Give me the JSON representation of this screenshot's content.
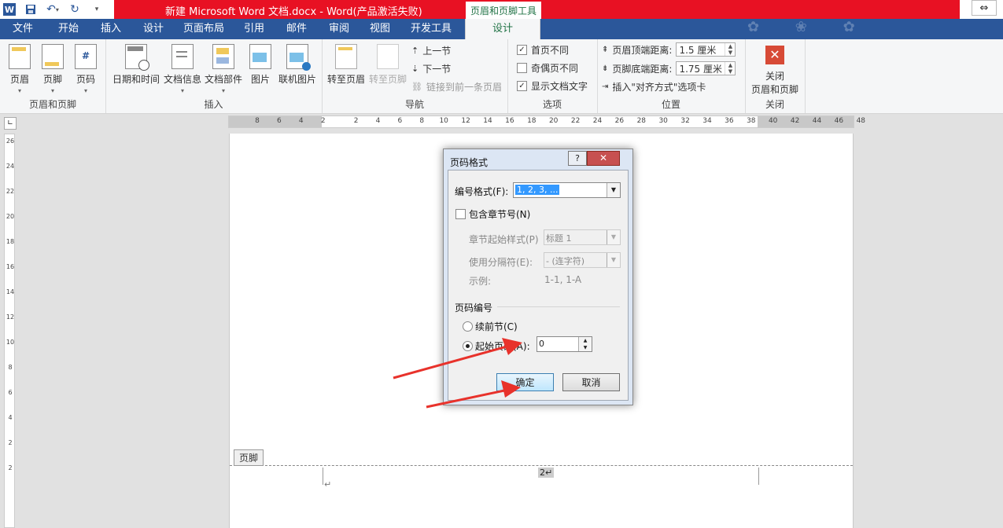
{
  "title_bar": {
    "document_title": "新建 Microsoft Word 文档.docx -  Word(产品激活失败)",
    "context_tab_title": "页眉和页脚工具",
    "restore_symbol": "⇔"
  },
  "qat": {
    "word_letter": "W"
  },
  "tabs": {
    "file": "文件",
    "home": "开始",
    "insert": "插入",
    "design_main": "设计",
    "page_layout": "页面布局",
    "references": "引用",
    "mailings": "邮件",
    "review": "审阅",
    "view": "视图",
    "developer": "开发工具",
    "hf_design": "设计"
  },
  "ribbon": {
    "group_header_footer": {
      "label": "页眉和页脚",
      "header": "页眉",
      "footer": "页脚",
      "page_number": "页码"
    },
    "group_insert": {
      "label": "插入",
      "date_time": "日期和时间",
      "doc_info": "文档信息",
      "doc_parts": "文档部件",
      "picture": "图片",
      "online_picture": "联机图片"
    },
    "group_nav": {
      "label": "导航",
      "goto_header": "转至页眉",
      "goto_footer": "转至页脚",
      "prev_section": "上一节",
      "next_section": "下一节",
      "link_prev": "链接到前一条页眉"
    },
    "group_options": {
      "label": "选项",
      "diff_first": "首页不同",
      "diff_odd_even": "奇偶页不同",
      "show_text": "显示文档文字",
      "diff_first_checked": true,
      "diff_odd_even_checked": false,
      "show_text_checked": true
    },
    "group_position": {
      "label": "位置",
      "header_top": "页眉顶端距离:",
      "header_top_value": "1.5 厘米",
      "footer_bottom": "页脚底端距离:",
      "footer_bottom_value": "1.75 厘米",
      "insert_align_tab": "插入\"对齐方式\"选项卡"
    },
    "group_close": {
      "label": "关闭",
      "close_hf_line1": "关闭",
      "close_hf_line2": "页眉和页脚"
    }
  },
  "ruler": {
    "horizontal": [
      "8",
      "6",
      "4",
      "2",
      "2",
      "4",
      "6",
      "8",
      "10",
      "12",
      "14",
      "16",
      "18",
      "20",
      "22",
      "24",
      "26",
      "28",
      "30",
      "32",
      "34",
      "36",
      "38",
      "40",
      "42",
      "44",
      "46",
      "48"
    ],
    "vertical": [
      "26",
      "24",
      "22",
      "20",
      "18",
      "16",
      "14",
      "12",
      "10",
      "8",
      "6",
      "4",
      "2",
      "2"
    ],
    "corner": "∟"
  },
  "document": {
    "footer_label": "页脚",
    "page_number_text": "2↵",
    "para_mark": "↵"
  },
  "dialog": {
    "title": "页码格式",
    "help": "?",
    "close": "✕",
    "number_format_label": "编号格式(F):",
    "number_format_value": "1, 2, 3, ...",
    "include_chapter_label": "包含章节号(N)",
    "chapter_style_label": "章节起始样式(P)",
    "chapter_style_value": "标题 1",
    "separator_label": "使用分隔符(E):",
    "separator_value": "-  (连字符)",
    "example_label": "示例:",
    "example_value": "1-1, 1-A",
    "numbering_section": "页码编号",
    "continue_label": "续前节(C)",
    "start_at_label": "起始页码(A):",
    "start_at_value": "0",
    "ok": "确定",
    "cancel": "取消"
  },
  "colors": {
    "title_red": "#e81123",
    "word_blue": "#2b579a",
    "contextual_green": "#217346",
    "arrow_red": "#e8322b"
  }
}
